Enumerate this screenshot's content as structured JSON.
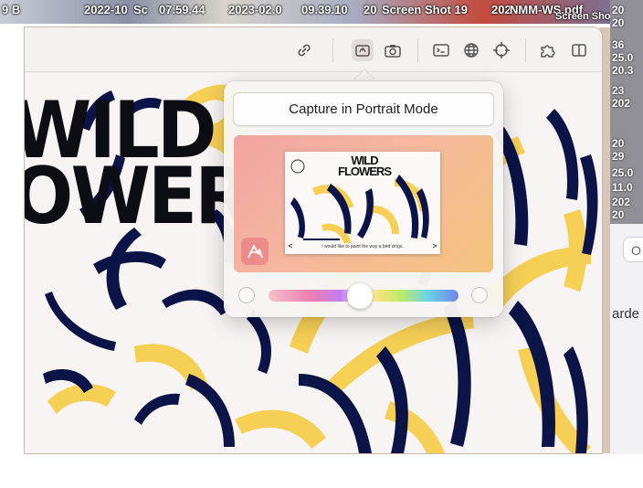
{
  "desktop": {
    "strip_labels": [
      "9 B",
      "2022-10",
      "Sc",
      "07.59.44",
      "2023-02.0",
      "09.39.10",
      "20",
      "Screen Shot 19",
      "202",
      "NMM-WS.pdf",
      "Screen Sho"
    ],
    "right_labels": [
      "20",
      "20",
      "36",
      "25.0",
      "20.3",
      "23",
      "202",
      "20",
      "29",
      "25.0",
      "11.0",
      "202",
      "20"
    ],
    "right_pill_text": "O",
    "right_text": "arde"
  },
  "toolbar": {
    "icons": [
      "link-icon",
      "web-clip-icon",
      "camera-icon",
      "terminal-icon",
      "globe-icon",
      "crosshair-icon",
      "extensions-icon",
      "sidebar-icon"
    ]
  },
  "page": {
    "hero_line1": "WILD",
    "hero_line2": "OWER",
    "colors": {
      "navy": "#0b1347",
      "yellow": "#f6cf55",
      "background": "#f8f4f3"
    }
  },
  "popover": {
    "portrait_button_label": "Capture in Portrait Mode",
    "thumbnail_title_line1": "WILD",
    "thumbnail_title_line2": "FLOWERS",
    "thumbnail_caption": "I would like to paint the way a bird sings.",
    "slider_value": 0.48,
    "gradient_colors": [
      "#f1a4a1",
      "#f5b7a0",
      "#f4c47c"
    ]
  }
}
